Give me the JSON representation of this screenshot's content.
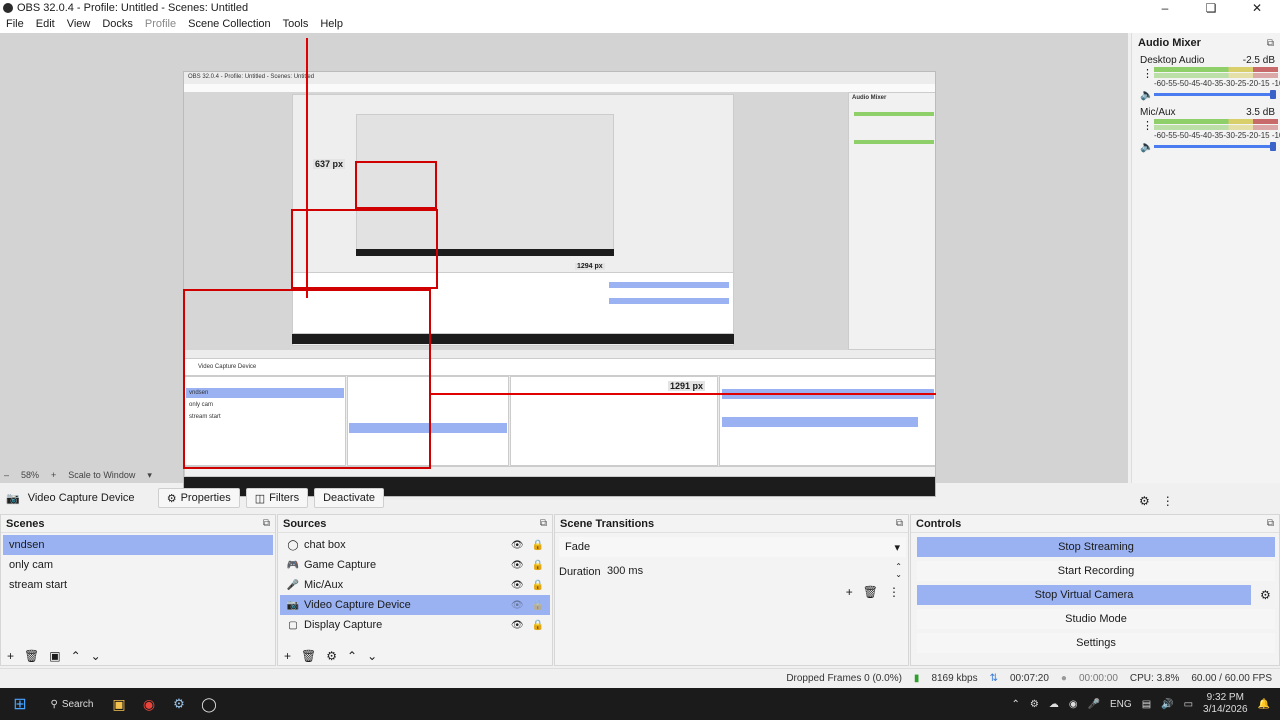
{
  "window": {
    "title": "OBS 32.0.4 - Profile: Untitled - Scenes: Untitled"
  },
  "menu": [
    "File",
    "Edit",
    "View",
    "Docks",
    "Profile",
    "Scene Collection",
    "Tools",
    "Help"
  ],
  "preview": {
    "inner_title": "OBS 32.0.4 - Profile: Untitled - Scenes: Untitled",
    "zoom": "58%",
    "scale_mode": "Scale to Window",
    "labels": [
      "637 px",
      "1291 px",
      "1294 px"
    ]
  },
  "audio_mixer": {
    "title": "Audio Mixer",
    "scale_ticks": "-60-55-50-45-40-35-30-25-20-15 -10 -5 0",
    "channels": [
      {
        "name": "Desktop Audio",
        "db": "-2.5 dB",
        "level": 0.98
      },
      {
        "name": "Mic/Aux",
        "db": "3.5 dB",
        "level": 0.98
      }
    ]
  },
  "source_toolbar": {
    "source_name": "Video Capture Device",
    "properties": "Properties",
    "filters": "Filters",
    "deactivate": "Deactivate"
  },
  "scenes": {
    "title": "Scenes",
    "items": [
      "vndsen",
      "only cam",
      "stream start"
    ]
  },
  "sources": {
    "title": "Sources",
    "items": [
      "chat box",
      "Game Capture",
      "Mic/Aux",
      "Video Capture Device",
      "Display Capture"
    ]
  },
  "transitions": {
    "title": "Scene Transitions",
    "selected": "Fade",
    "duration_label": "Duration",
    "duration_value": "300 ms"
  },
  "controls": {
    "title": "Controls",
    "buttons": [
      "Stop Streaming",
      "Start Recording",
      "Stop Virtual Camera",
      "Studio Mode",
      "Settings"
    ]
  },
  "status": {
    "dropped": "Dropped Frames 0 (0.0%)",
    "bitrate": "8169 kbps",
    "stream_time": "00:07:20",
    "rec_time": "00:00:00",
    "cpu": "CPU: 3.8%",
    "fps": "60.00 / 60.00 FPS"
  },
  "taskbar": {
    "search": "Search",
    "lang": "ENG",
    "time": "9:32 PM",
    "date": "3/14/2026"
  }
}
